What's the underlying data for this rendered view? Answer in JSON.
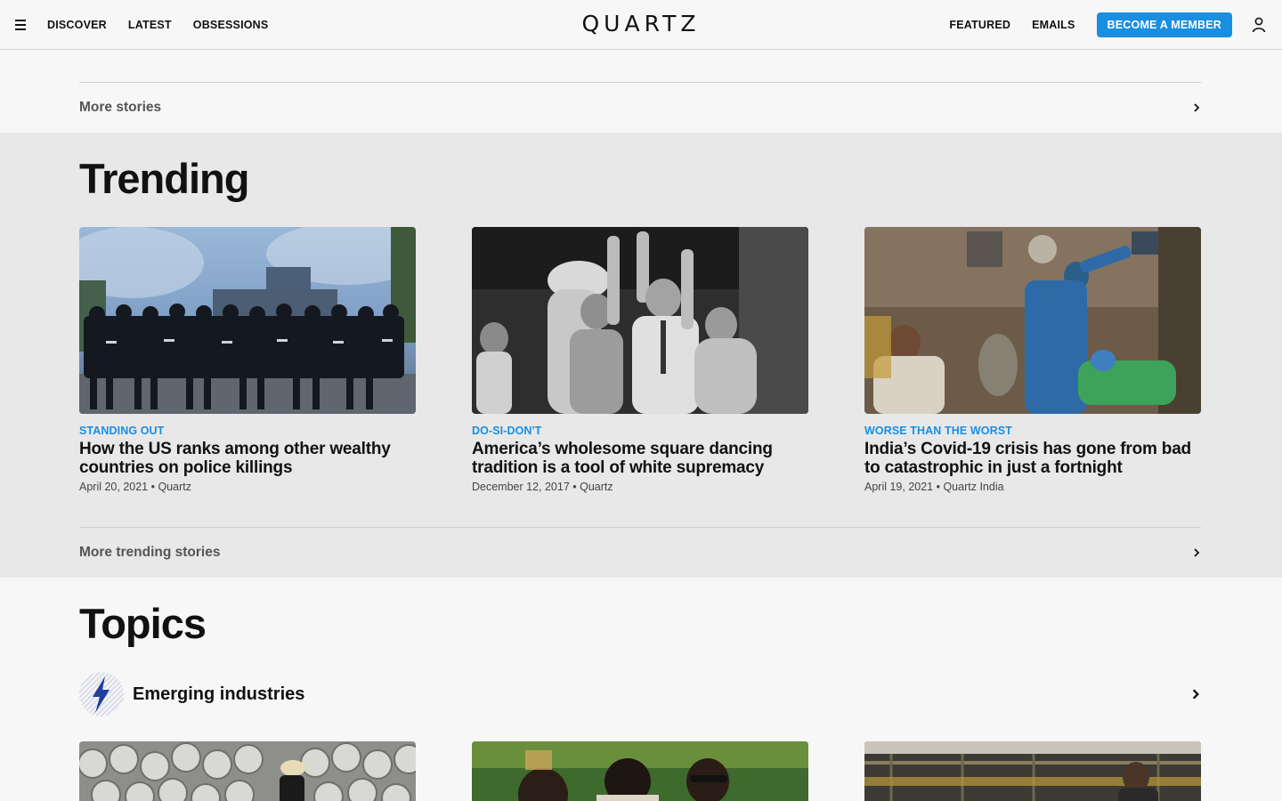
{
  "header": {
    "nav_left": [
      "DISCOVER",
      "LATEST",
      "OBSESSIONS"
    ],
    "logo": "QUARTZ",
    "nav_right": [
      "FEATURED",
      "EMAILS"
    ],
    "member_button": "BECOME A MEMBER"
  },
  "more_stories": {
    "label": "More stories"
  },
  "trending": {
    "title": "Trending",
    "cards": [
      {
        "kicker": "STANDING OUT",
        "headline": "How the US ranks among other wealthy countries on police killings",
        "meta": "April 20, 2021 • Quartz"
      },
      {
        "kicker": "DO-SI-DON'T",
        "headline": "America’s wholesome square dancing tradition is a tool of white supremacy",
        "meta": "December 12, 2017 • Quartz"
      },
      {
        "kicker": "WORSE THAN THE WORST",
        "headline": "India’s Covid-19 crisis has gone from bad to catastrophic in just a fortnight",
        "meta": "April 19, 2021 • Quartz India"
      }
    ],
    "more_label": "More trending stories"
  },
  "topics": {
    "title": "Topics",
    "items": [
      {
        "label": "Emerging industries"
      }
    ]
  },
  "colors": {
    "accent": "#1a8ee0",
    "trending_bg": "#e8e8e8",
    "page_bg": "#f7f7f7"
  },
  "icons": [
    "hamburger-icon",
    "user-icon",
    "chevron-right-icon",
    "lightning-icon"
  ]
}
